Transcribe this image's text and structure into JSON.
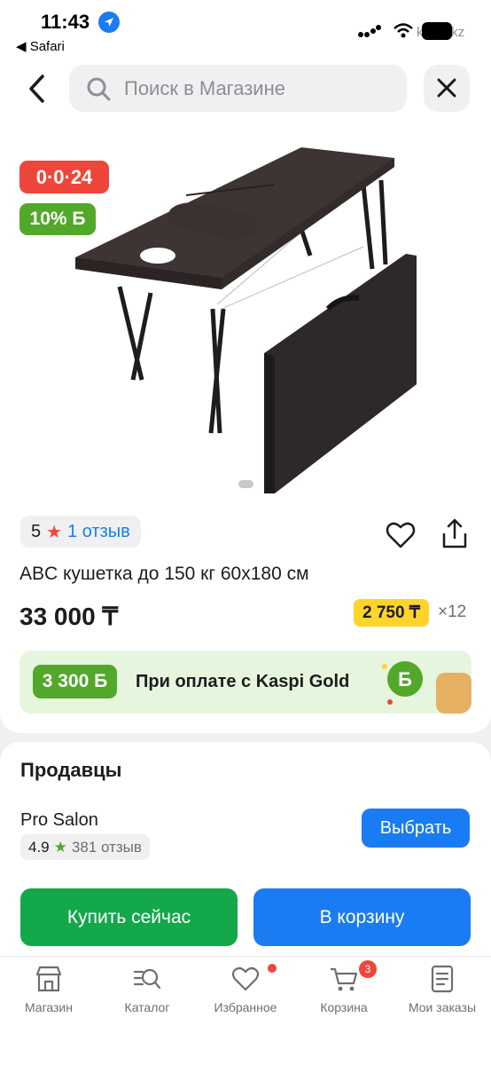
{
  "status_bar": {
    "time": "11:43",
    "back_app": "◀ Safari",
    "url": "kaspi.kz"
  },
  "search": {
    "placeholder": "Поиск в Магазине"
  },
  "product": {
    "timer_badge": "0·0·24",
    "bonus_badge": "10% Б",
    "rating": "5",
    "reviews": "1 отзыв",
    "title": "ABC кушетка до 150 кг 60x180 см",
    "price": "33 000 ₸",
    "installment_price": "2 750 ₸",
    "installment_months": "×12"
  },
  "gold_banner": {
    "bonus": "3 300 Б",
    "text": "При оплате с Kaspi Gold"
  },
  "sellers": {
    "title": "Продавцы",
    "seller_name": "Pro Salon",
    "seller_rating": "4.9",
    "seller_reviews": "381 отзыв",
    "choose_label": "Выбрать"
  },
  "actions": {
    "buy_now": "Купить сейчас",
    "add_to_cart": "В корзину"
  },
  "tabbar": {
    "items": [
      {
        "label": "Магазин",
        "icon": "store-icon"
      },
      {
        "label": "Каталог",
        "icon": "catalog-search-icon"
      },
      {
        "label": "Избранное",
        "icon": "heart-icon"
      },
      {
        "label": "Корзина",
        "icon": "cart-icon"
      },
      {
        "label": "Мои заказы",
        "icon": "orders-icon"
      }
    ],
    "cart_count": "3"
  },
  "colors": {
    "accent": "#1a7cf2",
    "buy": "#13a84a",
    "red": "#f0453a",
    "bonus_green": "#52a82a",
    "installment_yellow": "#ffd42a"
  }
}
